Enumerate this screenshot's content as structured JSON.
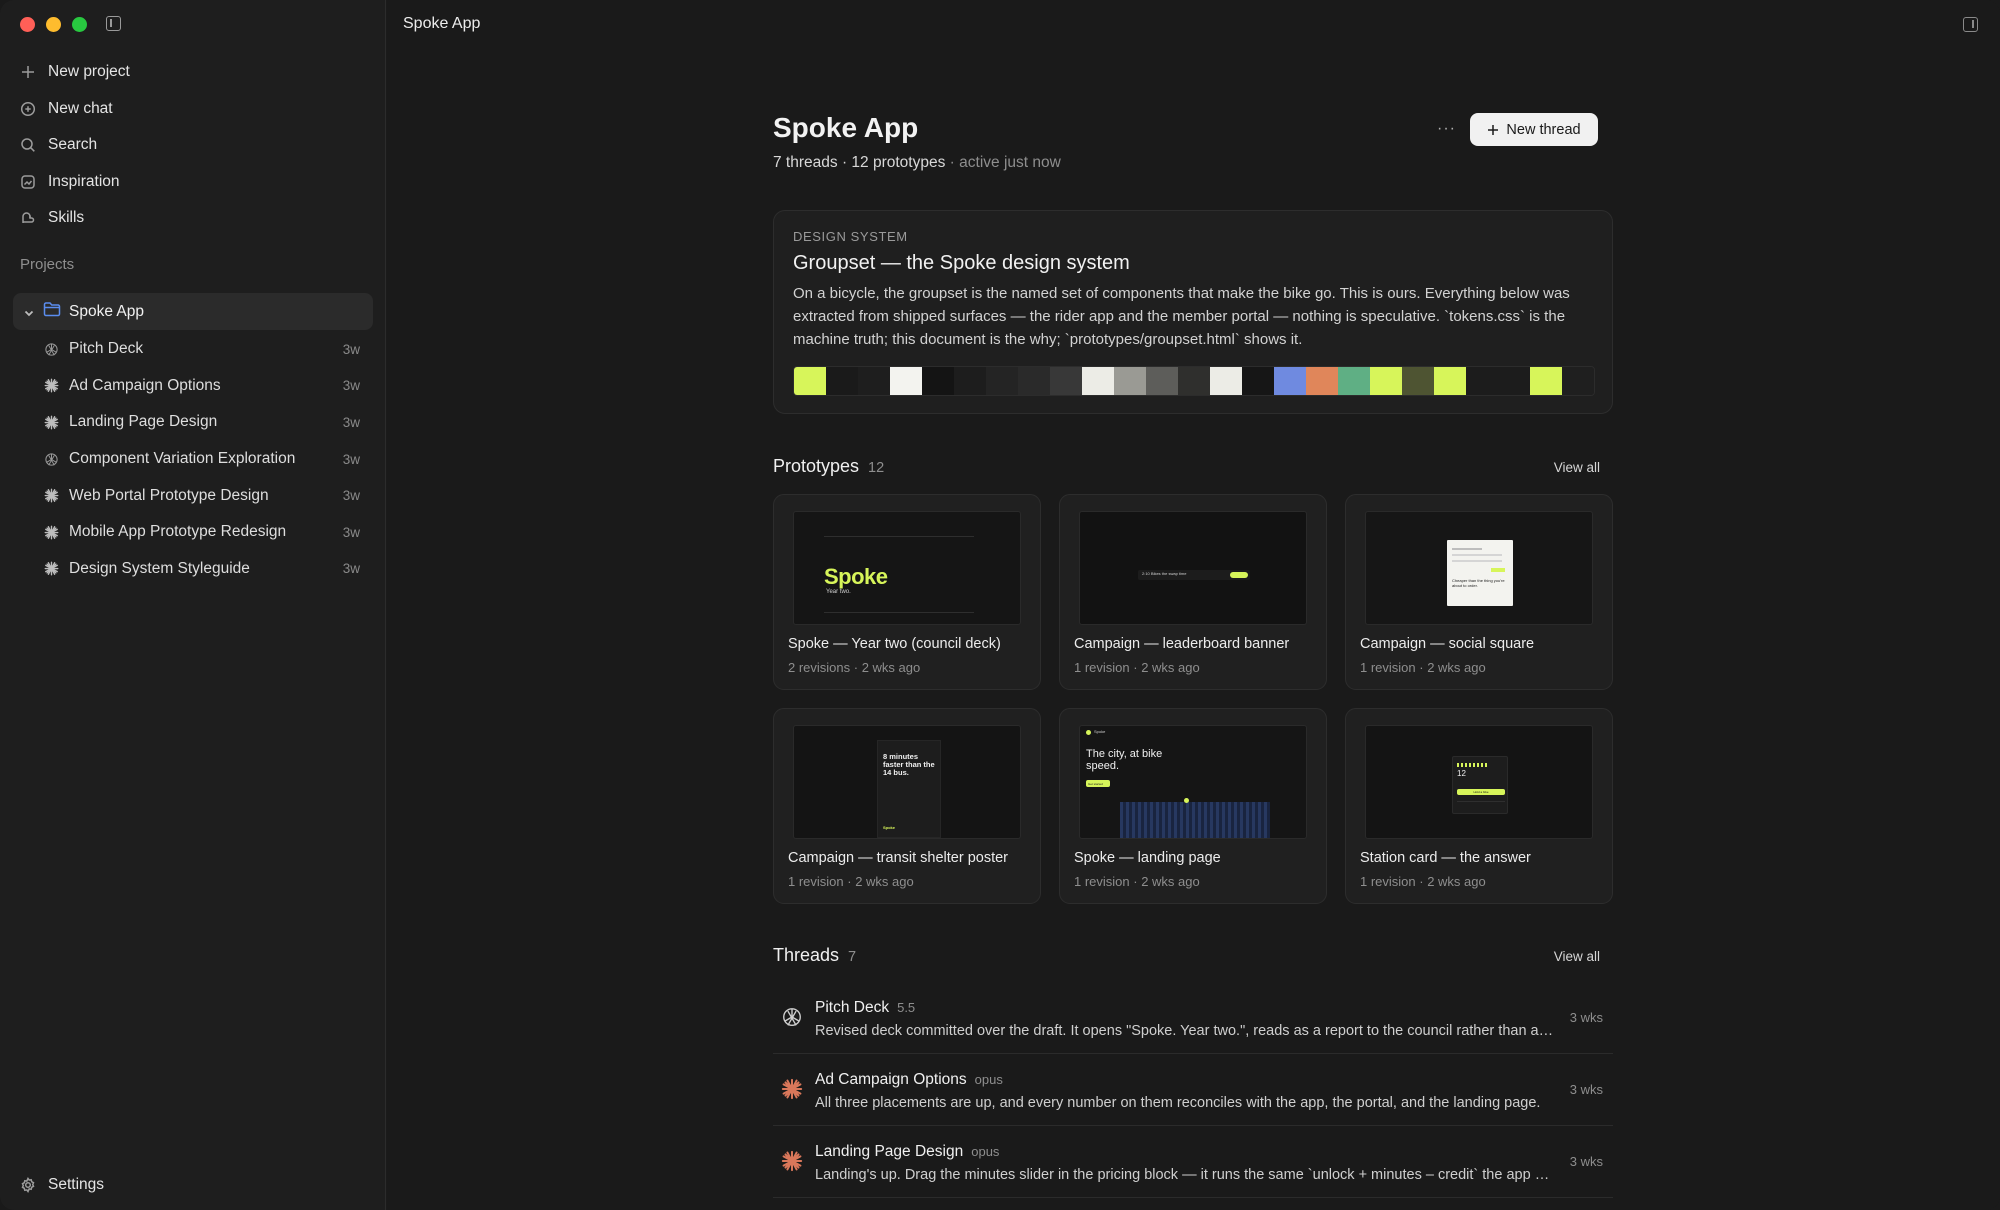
{
  "sidebar": {
    "nav": [
      {
        "label": "New project",
        "icon": "plus-icon"
      },
      {
        "label": "New chat",
        "icon": "new-chat-icon"
      },
      {
        "label": "Search",
        "icon": "search-icon"
      },
      {
        "label": "Inspiration",
        "icon": "inspiration-icon"
      },
      {
        "label": "Skills",
        "icon": "skills-icon"
      }
    ],
    "projects_label": "Projects",
    "project": {
      "name": "Spoke App"
    },
    "threads": [
      {
        "name": "Pitch Deck",
        "age": "3w",
        "icon": "openai-icon"
      },
      {
        "name": "Ad Campaign Options",
        "age": "3w",
        "icon": "claude-icon"
      },
      {
        "name": "Landing Page Design",
        "age": "3w",
        "icon": "claude-icon"
      },
      {
        "name": "Component Variation Exploration",
        "age": "3w",
        "icon": "openai-icon"
      },
      {
        "name": "Web Portal Prototype Design",
        "age": "3w",
        "icon": "claude-icon"
      },
      {
        "name": "Mobile App Prototype Redesign",
        "age": "3w",
        "icon": "claude-icon"
      },
      {
        "name": "Design System Styleguide",
        "age": "3w",
        "icon": "claude-icon"
      }
    ],
    "settings_label": "Settings"
  },
  "titlebar": {
    "title": "Spoke App"
  },
  "header": {
    "title": "Spoke App",
    "threads": "7 threads",
    "prototypes": "12 prototypes",
    "activity": "active just now",
    "more": "···",
    "new_thread_label": "New thread"
  },
  "design_system": {
    "eyebrow": "DESIGN SYSTEM",
    "title": "Groupset — the Spoke design system",
    "description": "On a bicycle, the groupset is the named set of components that make the bike go. This is ours. Everything below was extracted from shipped surfaces — the rider app and the member portal — nothing is speculative. `tokens.css` is the machine truth; this document is the why; `prototypes/groupset.html` shows it.",
    "swatches": [
      "#d7f55a",
      "#1a1a1a",
      "#1e1e1e",
      "#f3f3ef",
      "#141414",
      "#1d1d1d",
      "#242424",
      "#2a2a2a",
      "#383838",
      "#ececE6",
      "#9a9a94",
      "#5d5d5a",
      "#2f2f2d",
      "#ecece6",
      "#161616",
      "#6f8ae0",
      "#e0865a",
      "#5faf84",
      "#d7f55a",
      "#4e5432",
      "#d7f55a",
      "#1c1c1c",
      "#1c1c1c",
      "#d7f55a",
      "#1f1f1f"
    ]
  },
  "prototypes_section": {
    "title": "Prototypes",
    "count": "12",
    "view_all": "View all"
  },
  "prototypes": [
    {
      "title": "Spoke — Year two (council deck)",
      "meta": "2 revisions · 2 wks ago",
      "thumb": {
        "headline": "Spoke",
        "sub": "Year two."
      }
    },
    {
      "title": "Campaign — leaderboard banner",
      "meta": "1 revision · 2 wks ago",
      "thumb": {
        "headline": "2:10 Bikes the swap time"
      }
    },
    {
      "title": "Campaign — social square",
      "meta": "1 revision · 2 wks ago",
      "thumb": {
        "headline": "Cheaper than the thing you're about to order."
      }
    },
    {
      "title": "Campaign — transit shelter poster",
      "meta": "1 revision · 2 wks ago",
      "thumb": {
        "headline": "8 minutes faster than the 14 bus.",
        "brand": "Spoke"
      }
    },
    {
      "title": "Spoke — landing page",
      "meta": "1 revision · 2 wks ago",
      "thumb": {
        "brand": "Spoke",
        "headline": "The city, at bike speed.",
        "cta": "Get started"
      }
    },
    {
      "title": "Station card — the answer",
      "meta": "1 revision · 2 wks ago",
      "thumb": {
        "count": "12",
        "cta": "Hold a bike"
      }
    }
  ],
  "threads_section": {
    "title": "Threads",
    "count": "7",
    "view_all": "View all"
  },
  "thread_rows": [
    {
      "name": "Pitch Deck",
      "model": "5.5",
      "icon": "openai-icon",
      "summary": "Revised deck committed over the draft. It opens \"Spoke. Year two.\", reads as a report to the council rather than a pitch to investors.",
      "age": "3 wks"
    },
    {
      "name": "Ad Campaign Options",
      "model": "opus",
      "icon": "claude-icon",
      "summary": "All three placements are up, and every number on them reconciles with the app, the portal, and the landing page.",
      "age": "3 wks"
    },
    {
      "name": "Landing Page Design",
      "model": "opus",
      "icon": "claude-icon",
      "summary": "Landing's up. Drag the minutes slider in the pricing block — it runs the same `unlock + minutes – credit` the app uses.",
      "age": "3 wks"
    }
  ],
  "colors": {
    "accent": "#d7f55a",
    "claude": "#d9775a",
    "folder": "#5b8def"
  }
}
